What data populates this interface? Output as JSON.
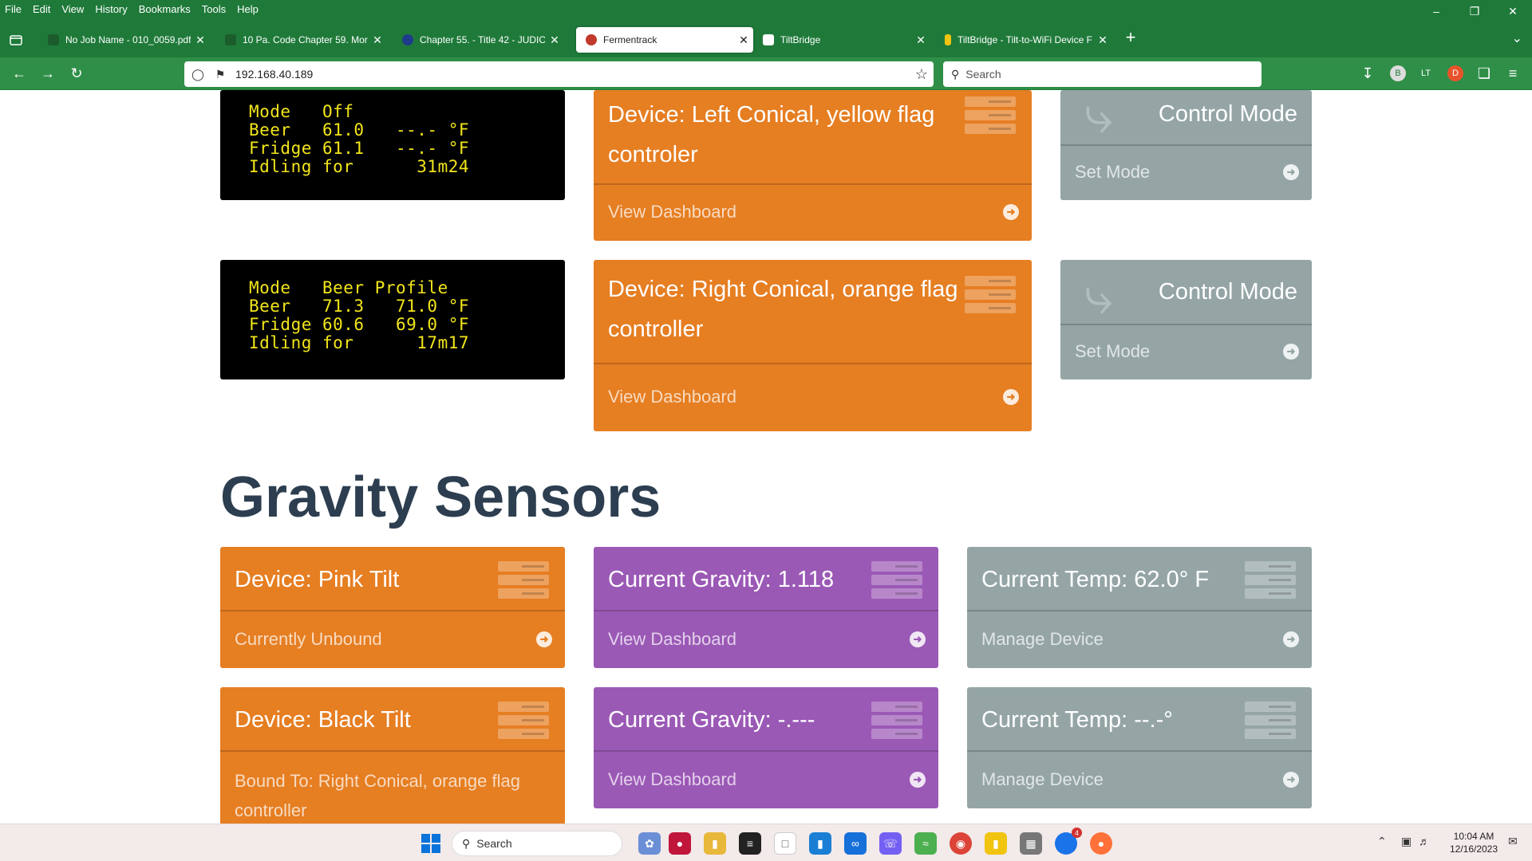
{
  "menu": [
    "File",
    "Edit",
    "View",
    "History",
    "Bookmarks",
    "Tools",
    "Help"
  ],
  "tabs": [
    {
      "label": "No Job Name - 010_0059.pdf",
      "fav_color": "#1c5c2c"
    },
    {
      "label": "10 Pa. Code Chapter 59. Mortga",
      "fav_color": "#1c5c2c"
    },
    {
      "label": "Chapter 55. - Title 42 - JUDICIA",
      "fav_color": "#1f3b8c"
    },
    {
      "label": "Fermentrack",
      "fav_color": "#c0392b"
    },
    {
      "label": "TiltBridge",
      "fav_color": "#ffffff"
    },
    {
      "label": "TiltBridge - Tilt-to-WiFi Device F",
      "fav_color": "#f1c40f"
    }
  ],
  "url": "192.168.40.189",
  "search_placeholder": "Search",
  "lcds": [
    {
      "text": "Mode   Off\nBeer   61.0   --.- °F\nFridge 61.1   --.- °F\nIdling for      31m24"
    },
    {
      "text": "Mode   Beer Profile\nBeer   71.3   71.0 °F\nFridge 60.6   69.0 °F\nIdling for      17m17"
    }
  ],
  "devices": [
    {
      "title": "Device: Left Conical, yellow flag controler",
      "link": "View Dashboard"
    },
    {
      "title": "Device: Right Conical, orange flag controller",
      "link": "View Dashboard"
    }
  ],
  "control": {
    "title": "Control Mode",
    "link": "Set Mode"
  },
  "gravity_heading": "Gravity Sensors",
  "sensors": [
    {
      "device": {
        "title": "Device: Pink Tilt",
        "link": "Currently Unbound"
      },
      "gravity": {
        "title": "Current Gravity: 1.118",
        "link": "View Dashboard"
      },
      "temp": {
        "title": "Current Temp: 62.0° F",
        "link": "Manage Device"
      }
    },
    {
      "device": {
        "title": "Device: Black Tilt",
        "link": "Bound To: Right Conical, orange flag controller"
      },
      "gravity": {
        "title": "Current Gravity: -.---",
        "link": "View Dashboard"
      },
      "temp": {
        "title": "Current Temp: --.-°",
        "link": "Manage Device"
      }
    }
  ],
  "taskbar": {
    "search": "Search",
    "time": "10:04 AM",
    "date": "12/16/2023",
    "badge": "4"
  },
  "colors": {
    "orange": "#e67e22",
    "purple": "#9b59b6",
    "gray": "#95a5a6",
    "chrome_green": "#1f7a3a",
    "heading": "#2c3e50",
    "lcd_text": "#f2e51a"
  }
}
